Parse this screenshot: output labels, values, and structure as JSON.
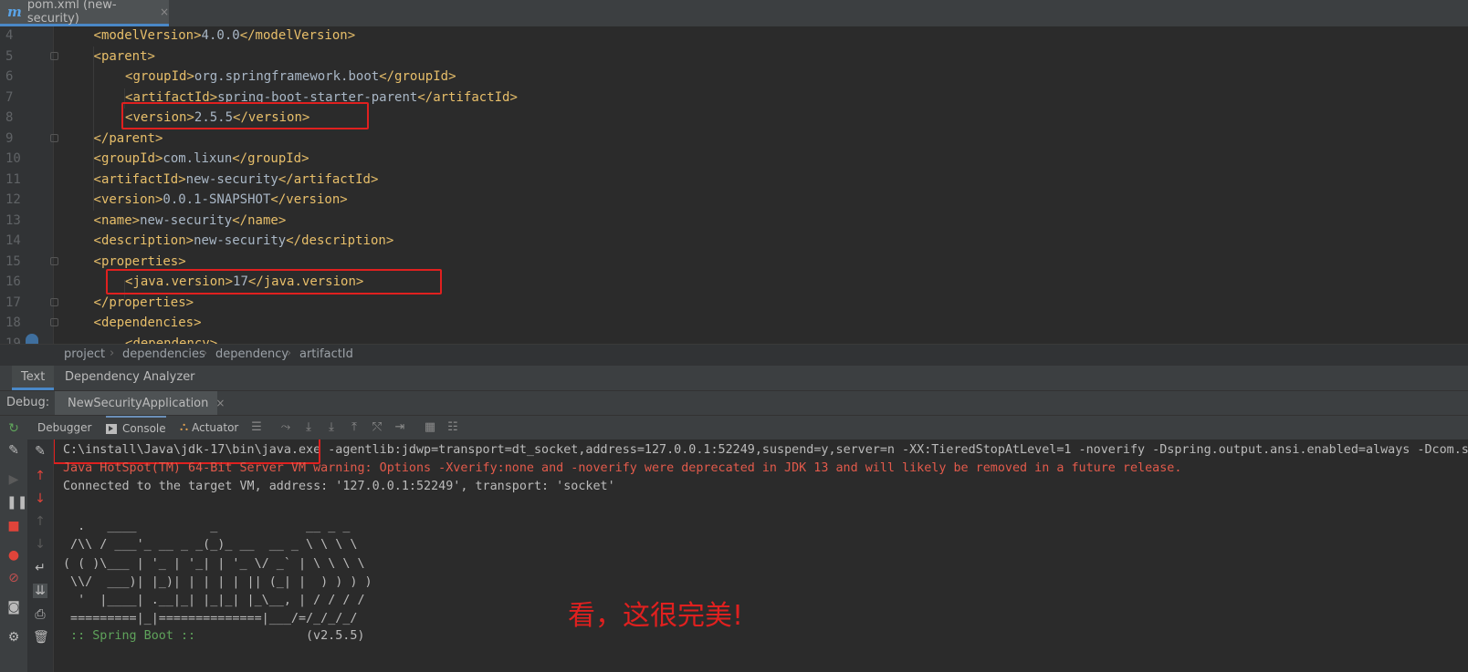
{
  "editor_tab": {
    "icon": "m",
    "label": "pom.xml (new-security)",
    "close": "×"
  },
  "code_lines": [
    {
      "num": "4",
      "parts": [
        [
          "punct",
          "<"
        ],
        [
          "tag",
          "modelVersion"
        ],
        [
          "punct",
          ">"
        ],
        [
          "txt",
          "4.0.0"
        ],
        [
          "punct",
          "</"
        ],
        [
          "tag",
          "modelVersion"
        ],
        [
          "punct",
          ">"
        ]
      ]
    },
    {
      "num": "5",
      "parts": [
        [
          "punct",
          "<"
        ],
        [
          "tag",
          "parent"
        ],
        [
          "punct",
          ">"
        ]
      ]
    },
    {
      "num": "6",
      "parts": [
        [
          "punct",
          "<"
        ],
        [
          "tag",
          "groupId"
        ],
        [
          "punct",
          ">"
        ],
        [
          "txt",
          "org.springframework.boot"
        ],
        [
          "punct",
          "</"
        ],
        [
          "tag",
          "groupId"
        ],
        [
          "punct",
          ">"
        ]
      ]
    },
    {
      "num": "7",
      "parts": [
        [
          "punct",
          "<"
        ],
        [
          "tag",
          "artifactId"
        ],
        [
          "punct",
          ">"
        ],
        [
          "txt",
          "spring-boot-starter-parent"
        ],
        [
          "punct",
          "</"
        ],
        [
          "tag",
          "artifactId"
        ],
        [
          "punct",
          ">"
        ]
      ]
    },
    {
      "num": "8",
      "parts": [
        [
          "punct",
          "<"
        ],
        [
          "tag",
          "version"
        ],
        [
          "punct",
          ">"
        ],
        [
          "txt",
          "2.5.5"
        ],
        [
          "punct",
          "</"
        ],
        [
          "tag",
          "version"
        ],
        [
          "punct",
          ">"
        ]
      ]
    },
    {
      "num": "9",
      "parts": [
        [
          "punct",
          "</"
        ],
        [
          "tag",
          "parent"
        ],
        [
          "punct",
          ">"
        ]
      ]
    },
    {
      "num": "10",
      "parts": [
        [
          "punct",
          "<"
        ],
        [
          "tag",
          "groupId"
        ],
        [
          "punct",
          ">"
        ],
        [
          "txt",
          "com.lixun"
        ],
        [
          "punct",
          "</"
        ],
        [
          "tag",
          "groupId"
        ],
        [
          "punct",
          ">"
        ]
      ]
    },
    {
      "num": "11",
      "parts": [
        [
          "punct",
          "<"
        ],
        [
          "tag",
          "artifactId"
        ],
        [
          "punct",
          ">"
        ],
        [
          "txt",
          "new-security"
        ],
        [
          "punct",
          "</"
        ],
        [
          "tag",
          "artifactId"
        ],
        [
          "punct",
          ">"
        ]
      ]
    },
    {
      "num": "12",
      "parts": [
        [
          "punct",
          "<"
        ],
        [
          "tag",
          "version"
        ],
        [
          "punct",
          ">"
        ],
        [
          "txt",
          "0.0.1-SNAPSHOT"
        ],
        [
          "punct",
          "</"
        ],
        [
          "tag",
          "version"
        ],
        [
          "punct",
          ">"
        ]
      ]
    },
    {
      "num": "13",
      "parts": [
        [
          "punct",
          "<"
        ],
        [
          "tag",
          "name"
        ],
        [
          "punct",
          ">"
        ],
        [
          "txt",
          "new-security"
        ],
        [
          "punct",
          "</"
        ],
        [
          "tag",
          "name"
        ],
        [
          "punct",
          ">"
        ]
      ]
    },
    {
      "num": "14",
      "parts": [
        [
          "punct",
          "<"
        ],
        [
          "tag",
          "description"
        ],
        [
          "punct",
          ">"
        ],
        [
          "txt",
          "new-security"
        ],
        [
          "punct",
          "</"
        ],
        [
          "tag",
          "description"
        ],
        [
          "punct",
          ">"
        ]
      ]
    },
    {
      "num": "15",
      "parts": [
        [
          "punct",
          "<"
        ],
        [
          "tag",
          "properties"
        ],
        [
          "punct",
          ">"
        ]
      ]
    },
    {
      "num": "16",
      "parts": [
        [
          "punct",
          "<"
        ],
        [
          "tag",
          "java.version"
        ],
        [
          "punct",
          ">"
        ],
        [
          "txt",
          "17"
        ],
        [
          "punct",
          "</"
        ],
        [
          "tag",
          "java.version"
        ],
        [
          "punct",
          ">"
        ]
      ]
    },
    {
      "num": "17",
      "parts": [
        [
          "punct",
          "</"
        ],
        [
          "tag",
          "properties"
        ],
        [
          "punct",
          ">"
        ]
      ]
    },
    {
      "num": "18",
      "parts": [
        [
          "punct",
          "<"
        ],
        [
          "tag",
          "dependencies"
        ],
        [
          "punct",
          ">"
        ]
      ]
    },
    {
      "num": "19",
      "parts": [
        [
          "punct",
          "<"
        ],
        [
          "tag",
          "dependency"
        ],
        [
          "punct",
          ">"
        ]
      ]
    }
  ],
  "breadcrumb": [
    "project",
    "dependencies",
    "dependency",
    "artifactId"
  ],
  "editor_subtabs": [
    "Text",
    "Dependency Analyzer"
  ],
  "debug": {
    "label": "Debug:",
    "session": "NewSecurityApplication",
    "session_close": "×"
  },
  "debugger_tabs": {
    "debugger": "Debugger",
    "console": "Console",
    "actuator": "Actuator"
  },
  "console": {
    "cmd_exe": "C:\\install\\Java\\jdk-17\\bin\\java.exe",
    "cmd_args": " -agentlib:jdwp=transport=dt_socket,address=127.0.0.1:52249,suspend=y,server=n -XX:TieredStopAtLevel=1 -noverify -Dspring.output.ansi.enabled=always -Dcom.sun.",
    "warning": "Java HotSpot(TM) 64-Bit Server VM warning: Options -Xverify:none and -noverify were deprecated in JDK 13 and will likely be removed in a future release.",
    "connected": "Connected to the target VM, address: '127.0.0.1:52249', transport: 'socket'",
    "banner": [
      "  .   ____          _            __ _ _",
      " /\\\\ / ___'_ __ _ _(_)_ __  __ _ \\ \\ \\ \\",
      "( ( )\\___ | '_ | '_| | '_ \\/ _` | \\ \\ \\ \\",
      " \\\\/  ___)| |_)| | | | | || (_| |  ) ) ) )",
      "  '  |____| .__|_| |_|_| |_\\__, | / / / /",
      " =========|_|==============|___/=/_/_/_/"
    ],
    "spring_label": " :: Spring Boot ::",
    "spring_version": "(v2.5.5)"
  },
  "annotation": "看，这很完美!",
  "colors": {
    "highlight_box": "#e0201f",
    "xml_tag": "#e8bf6a",
    "warning": "#e25a4b",
    "spring": "#5fa35b"
  }
}
